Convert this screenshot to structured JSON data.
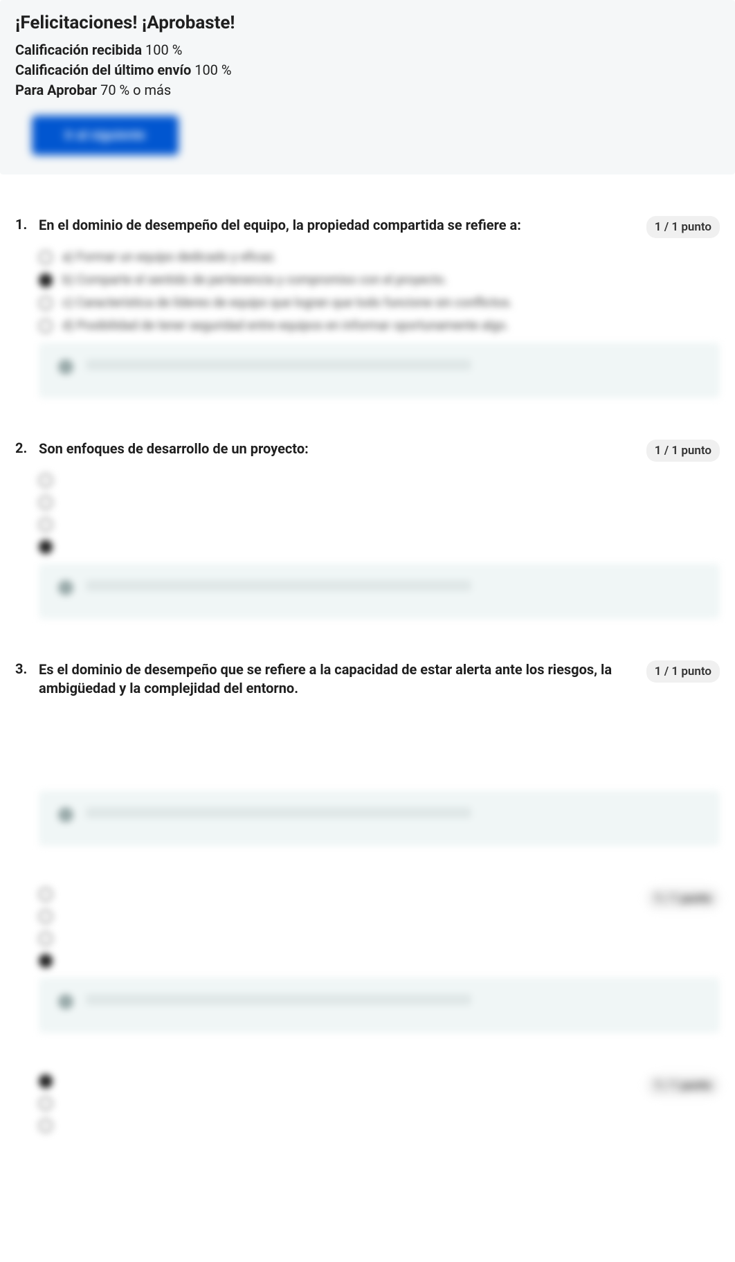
{
  "header": {
    "title": "¡Felicitaciones! ¡Aprobaste!",
    "grade_label": "Calificación recibida",
    "grade_value": "100 %",
    "last_label": "Calificación del último envío",
    "last_value": "100 %",
    "pass_label": "Para Aprobar",
    "pass_value": "70 % o más",
    "button": "Ir al siguiente"
  },
  "score_text": "1 / 1 punto",
  "questions": [
    {
      "num": "1.",
      "text": "En el dominio de desempeño del equipo, la propiedad compartida se refiere a:",
      "options": [
        {
          "selected": false,
          "label": "a) Formar un equipo dedicado y eficaz."
        },
        {
          "selected": true,
          "label": "b) Comparte el sentido de pertenencia y compromiso con el proyecto."
        },
        {
          "selected": false,
          "label": "c) Característica de líderes de equipo que logran que todo funcione sin conflictos."
        },
        {
          "selected": false,
          "label": "d) Posibilidad de tener seguridad entre equipos en informar oportunamente algo."
        }
      ]
    },
    {
      "num": "2.",
      "text": "Son enfoques de desarrollo de un proyecto:",
      "options": [
        {
          "selected": false,
          "label": ""
        },
        {
          "selected": false,
          "label": ""
        },
        {
          "selected": false,
          "label": ""
        },
        {
          "selected": true,
          "label": ""
        }
      ]
    },
    {
      "num": "3.",
      "text": "Es el dominio de desempeño que se refiere a la capacidad de estar alerta ante los riesgos, la ambigüedad y la complejidad del entorno.",
      "options": []
    },
    {
      "num": "",
      "text": "",
      "options": [
        {
          "selected": false,
          "label": ""
        },
        {
          "selected": false,
          "label": ""
        },
        {
          "selected": false,
          "label": ""
        },
        {
          "selected": true,
          "label": ""
        }
      ]
    },
    {
      "num": "",
      "text": "",
      "options": [
        {
          "selected": true,
          "label": ""
        },
        {
          "selected": false,
          "label": ""
        },
        {
          "selected": false,
          "label": ""
        }
      ]
    }
  ]
}
